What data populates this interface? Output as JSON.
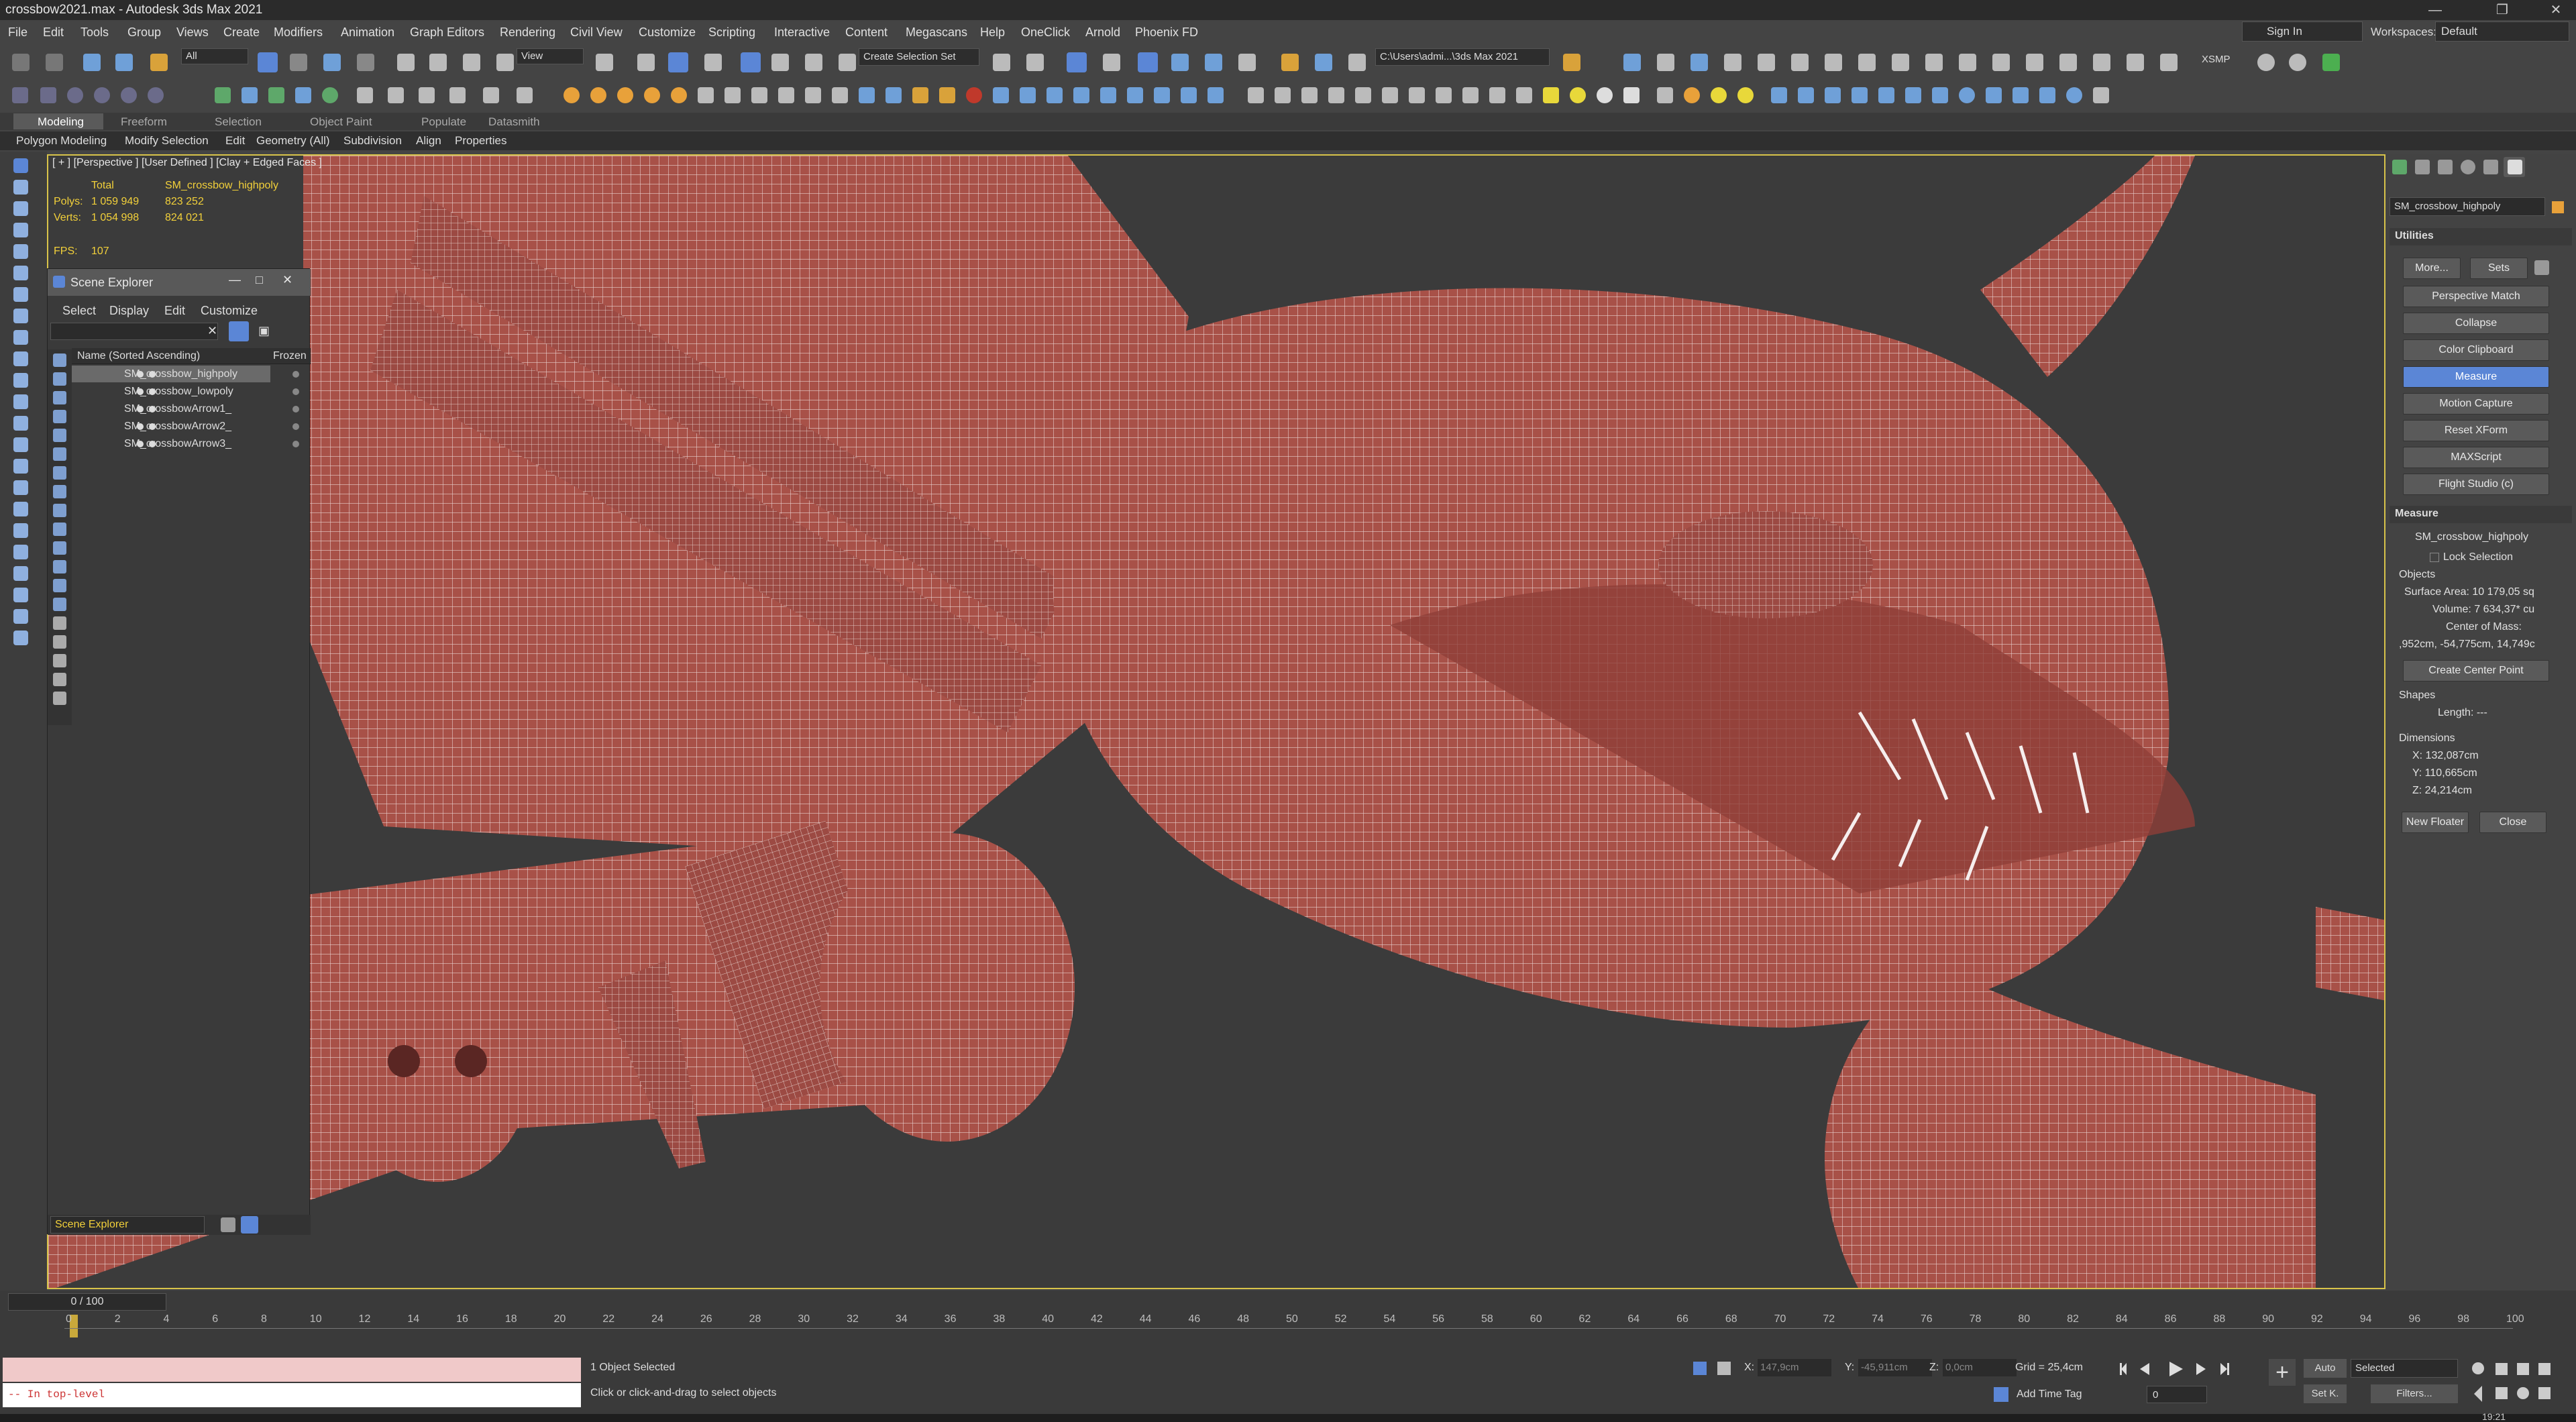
{
  "window": {
    "title": "crossbow2021.max - Autodesk 3ds Max 2021"
  },
  "menu": [
    "File",
    "Edit",
    "Tools",
    "Group",
    "Views",
    "Create",
    "Modifiers",
    "Animation",
    "Graph Editors",
    "Rendering",
    "Civil View",
    "Customize",
    "Scripting",
    "Interactive",
    "Content",
    "Megascans",
    "Help",
    "OneClick",
    "Arnold",
    "Phoenix FD"
  ],
  "signin": "Sign In",
  "workspaces_label": "Workspaces:",
  "workspaces_value": "Default",
  "toolbar": {
    "selection_filter": "All",
    "view_dropdown": "View",
    "named_selection": "Create Selection Set",
    "path": "C:\\Users\\admi...\\3ds Max 2021",
    "xsmp": "XSMP"
  },
  "ribbon_tabs": [
    "Modeling",
    "Freeform",
    "Selection",
    "Object Paint",
    "Populate",
    "Datasmith"
  ],
  "ribbon_sub": [
    "Polygon Modeling",
    "Modify Selection",
    "Edit",
    "Geometry (All)",
    "Subdivision",
    "Align",
    "Properties"
  ],
  "viewport": {
    "label": "[ + ] [Perspective ] [User Defined ] [Clay + Edged Faces ]",
    "stats_total": "Total",
    "stats_obj": "SM_crossbow_highpoly",
    "polys_label": "Polys:",
    "polys_total": "1 059 949",
    "polys_obj": "823 252",
    "verts_label": "Verts:",
    "verts_total": "1 054 998",
    "verts_obj": "824 021",
    "fps_label": "FPS:",
    "fps_value": "107"
  },
  "scene_explorer": {
    "title": "Scene Explorer",
    "menu": [
      "Select",
      "Display",
      "Edit",
      "Customize"
    ],
    "col_name": "Name (Sorted Ascending)",
    "col_frozen": "Frozen",
    "items": [
      "SM_crossbow_highpoly",
      "SM_crossbow_lowpoly",
      "SM_crossbowArrow1_",
      "SM_crossbowArrow2_",
      "SM_crossbowArrow3_"
    ],
    "footer": "Scene Explorer"
  },
  "right_panel": {
    "object_name": "SM_crossbow_highpoly",
    "utilities_header": "Utilities",
    "more": "More...",
    "sets": "Sets",
    "buttons": [
      "Perspective Match",
      "Collapse",
      "Color Clipboard",
      "Measure",
      "Motion Capture",
      "Reset XForm",
      "MAXScript",
      "Flight Studio (c)"
    ],
    "measure_header": "Measure",
    "measure_obj": "SM_crossbow_highpoly",
    "lock_selection": "Lock Selection",
    "objects": "Objects",
    "surface_area": "Surface Area: 10 179,05 sq",
    "volume": "Volume: 7 634,37* cu",
    "center_of_mass": "Center of Mass:",
    "com_value": ",952cm, -54,775cm, 14,749c",
    "create_center_point": "Create Center Point",
    "shapes": "Shapes",
    "length": "Length: ---",
    "dimensions": "Dimensions",
    "dim_x": "X:  132,087cm",
    "dim_y": "Y:  110,665cm",
    "dim_z": "Z:  24,214cm",
    "new_floater": "New Floater",
    "close": "Close"
  },
  "timeline": {
    "frame": "0 / 100",
    "ticks": [
      "0",
      "2",
      "4",
      "6",
      "8",
      "10",
      "12",
      "14",
      "16",
      "18",
      "20",
      "22",
      "24",
      "26",
      "28",
      "30",
      "32",
      "34",
      "36",
      "38",
      "40",
      "42",
      "44",
      "46",
      "48",
      "50",
      "52",
      "54",
      "56",
      "58",
      "60",
      "62",
      "64",
      "66",
      "68",
      "70",
      "72",
      "74",
      "76",
      "78",
      "80",
      "82",
      "84",
      "86",
      "88",
      "90",
      "92",
      "94",
      "96",
      "98",
      "100"
    ]
  },
  "status": {
    "maxscript": "-- In top-level",
    "selected": "1 Object Selected",
    "hint": "Click or click-and-drag to select objects",
    "x": "147,9cm",
    "y": "-45,911cm",
    "z": "0,0cm",
    "grid": "Grid = 25,4cm",
    "add_time_tag": "Add Time Tag",
    "auto": "Auto",
    "set_k": "Set K.",
    "selected_dd": "Selected",
    "filters": "Filters...",
    "frame_field": "0",
    "clock": "19:21"
  },
  "colors": {
    "accent": "#5b86d6",
    "viewport_border": "#d8c34a",
    "mesh": "#b05a52",
    "wire": "#f3e6e3"
  }
}
